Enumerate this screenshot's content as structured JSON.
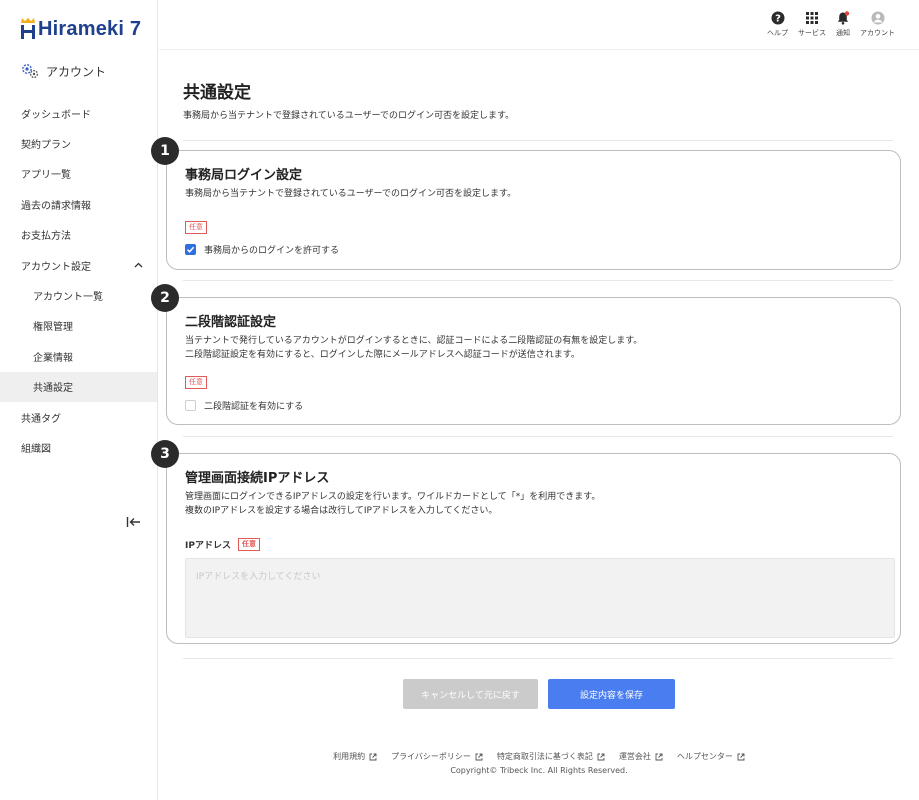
{
  "brand": {
    "logo_text": "Hirameki 7",
    "accent": "#2f6fe0",
    "badge_color": "#e05a5a"
  },
  "sidebar": {
    "section_title": "アカウント",
    "items": [
      {
        "label": "ダッシュボード"
      },
      {
        "label": "契約プラン"
      },
      {
        "label": "アプリ一覧"
      },
      {
        "label": "過去の請求情報"
      },
      {
        "label": "お支払方法"
      },
      {
        "label": "アカウント設定",
        "expanded": true
      },
      {
        "label": "アカウント一覧"
      },
      {
        "label": "権限管理"
      },
      {
        "label": "企業情報"
      },
      {
        "label": "共通設定",
        "active": true
      },
      {
        "label": "共通タグ"
      },
      {
        "label": "組織図"
      }
    ]
  },
  "header": {
    "help_label": "ヘルプ",
    "services_label": "サービス",
    "notifications_label": "通知",
    "account_label": "アカウント"
  },
  "page": {
    "title": "共通設定",
    "description": "事務局から当テナントで登録されているユーザーでのログイン可否を設定します。"
  },
  "sections": [
    {
      "number": "1",
      "title": "事務局ログイン設定",
      "description": "事務局から当テナントで登録されているユーザーでのログイン可否を設定します。",
      "badge": "任意",
      "checkbox_label": "事務局からのログインを許可する",
      "checked": true
    },
    {
      "number": "2",
      "title": "二段階認証設定",
      "description_line1": "当テナントで発行しているアカウントがログインするときに、認証コードによる二段階認証の有無を設定します。",
      "description_line2": "二段階認証設定を有効にすると、ログインした際にメールアドレスへ認証コードが送信されます。",
      "badge": "任意",
      "checkbox_label": "二段階認証を有効にする",
      "checked": false
    },
    {
      "number": "3",
      "title": "管理画面接続IPアドレス",
      "description_line1": "管理画面にログインできるIPアドレスの設定を行います。ワイルドカードとして「*」を利用できます。",
      "description_line2": "複数のIPアドレスを設定する場合は改行してIPアドレスを入力してください。",
      "field_label": "IPアドレス",
      "badge": "任意",
      "placeholder": "IPアドレスを入力してください",
      "value": ""
    }
  ],
  "actions": {
    "cancel_label": "キャンセルして元に戻す",
    "save_label": "設定内容を保存"
  },
  "footer": {
    "links": [
      "利用規約",
      "プライバシーポリシー",
      "特定商取引法に基づく表記",
      "運営会社",
      "ヘルプセンター"
    ],
    "copyright": "Copyright© Tribeck Inc. All Rights Reserved."
  }
}
